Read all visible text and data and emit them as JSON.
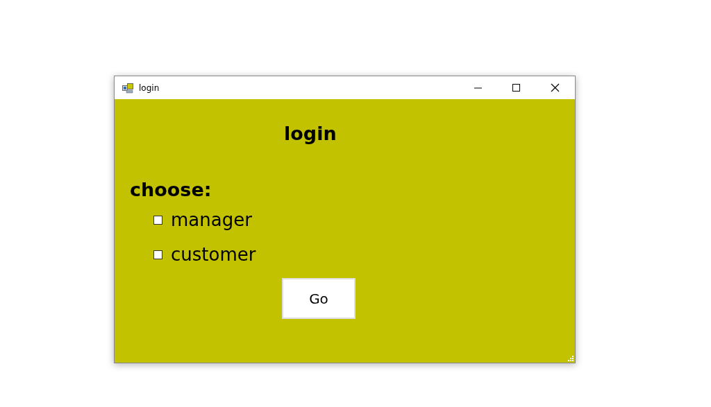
{
  "window": {
    "title": "login"
  },
  "heading": "login",
  "prompt": "choose:",
  "options": [
    {
      "label": "manager",
      "checked": false
    },
    {
      "label": "customer",
      "checked": false
    }
  ],
  "button": "Go"
}
